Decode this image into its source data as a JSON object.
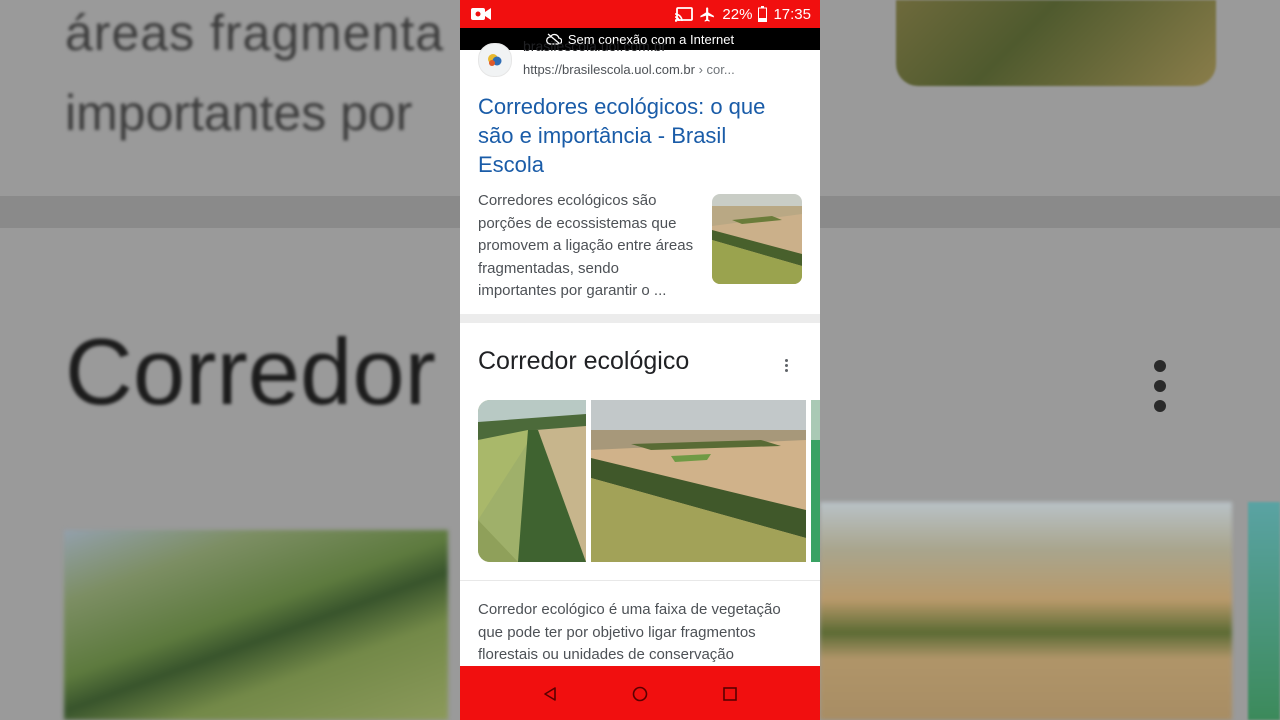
{
  "background": {
    "text_line1": "áreas fragmenta",
    "text_line2": "importantes por",
    "title": "Corredor      ico"
  },
  "status_bar": {
    "battery": "22%",
    "time": "17:35",
    "color": "#f10f0f"
  },
  "offline_banner": {
    "icon": "cloud-off-icon",
    "text": "Sem conexão com a Internet"
  },
  "result": {
    "site_name": "brasilescola.uol.com.br",
    "url": "https://brasilescola.uol.com.br",
    "url_crumb": "› cor...",
    "title": "Corredores ecológicos: o que são e importância - Brasil Escola",
    "snippet": "Corredores ecológicos são porções de ecossistemas que promovem a ligação entre áreas fragmentadas, sendo importantes por garantir o ...",
    "link_color": "#1a5ca8"
  },
  "knowledge_panel": {
    "title": "Corredor ecológico",
    "menu_icon": "more-vert-icon",
    "description": "Corredor ecológico é uma faixa de vegetação que pode ter por objetivo ligar fragmentos florestais ou unidades de conservação"
  },
  "nav_bar": {
    "buttons": [
      "back-icon",
      "home-icon",
      "recents-icon"
    ]
  }
}
